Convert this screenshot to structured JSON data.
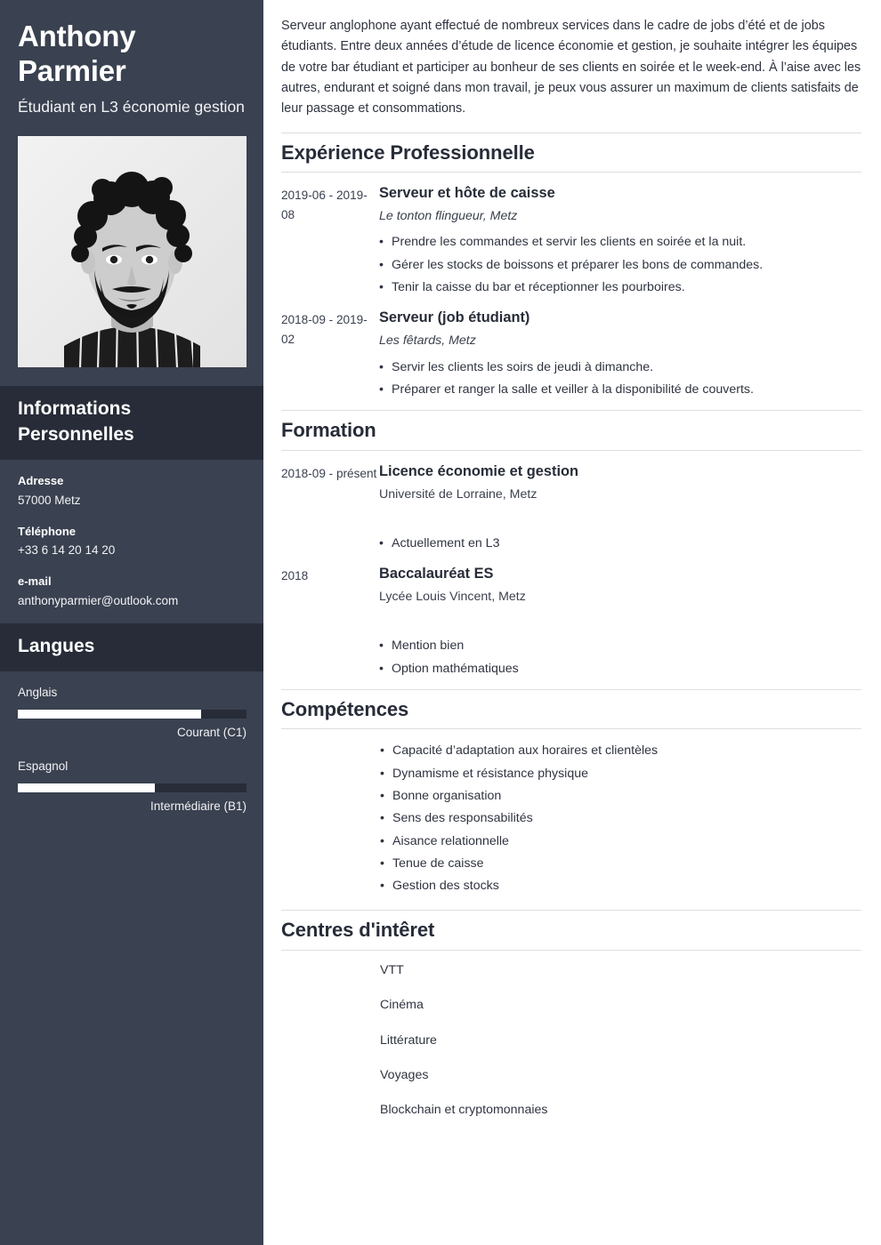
{
  "colors": {
    "sidebar_bg": "#3a4150",
    "sidebar_band_bg": "#272c38",
    "heading": "#272c38",
    "body_text": "#2f3440",
    "rule": "#dcdee1",
    "bar_fill": "#ffffff"
  },
  "sidebar": {
    "full_name": "Anthony Parmier",
    "job_title": "Étudiant en L3 économie gestion",
    "photo_alt": "portrait-photo",
    "personal_info_heading": "Informations Personnelles",
    "contacts": [
      {
        "label": "Adresse",
        "value": "57000 Metz"
      },
      {
        "label": "Téléphone",
        "value": "+33 6 14 20 14 20"
      },
      {
        "label": "e-mail",
        "value": "anthonyparmier@outlook.com"
      }
    ],
    "languages_heading": "Langues",
    "languages": [
      {
        "name": "Anglais",
        "level": "Courant (C1)",
        "percent": 80
      },
      {
        "name": "Espagnol",
        "level": "Intermédiaire (B1)",
        "percent": 60
      }
    ]
  },
  "main": {
    "summary": "Serveur anglophone ayant effectué de nombreux services dans le cadre de jobs d’été et de jobs étudiants. Entre deux années d’étude de licence économie et gestion, je souhaite intégrer les équipes de votre bar étudiant et participer au bonheur de ses clients en soirée et le week-end. À l’aise avec les autres, endurant et soigné dans mon travail, je peux vous assurer un maximum de clients satisfaits de leur passage et consommations.",
    "experience": {
      "heading": "Expérience Professionnelle",
      "entries": [
        {
          "date": "2019-06 - 2019-08",
          "title": "Serveur et hôte de caisse",
          "org": "Le tonton flingueur, Metz",
          "bullets": [
            "Prendre les commandes et servir les clients en soirée et la nuit.",
            "Gérer les stocks de boissons et préparer les bons de commandes.",
            "Tenir la caisse du bar et réceptionner les pourboires."
          ]
        },
        {
          "date": "2018-09 - 2019-02",
          "title": "Serveur (job étudiant)",
          "org": "Les fêtards, Metz",
          "bullets": [
            "Servir les clients les soirs de jeudi à dimanche.",
            "Préparer et ranger la salle et veiller à la disponibilité de couverts."
          ]
        }
      ]
    },
    "education": {
      "heading": "Formation",
      "entries": [
        {
          "date": "2018-09 - présent",
          "title": "Licence économie et gestion",
          "org": "Université de Lorraine, Metz",
          "bullets": [
            "Actuellement en L3"
          ]
        },
        {
          "date": "2018",
          "title": "Baccalauréat ES",
          "org": "Lycée Louis Vincent, Metz",
          "bullets": [
            "Mention bien",
            "Option mathématiques"
          ]
        }
      ]
    },
    "skills": {
      "heading": "Compétences",
      "items": [
        "Capacité d’adaptation aux horaires et clientèles",
        "Dynamisme et résistance physique",
        "Bonne organisation",
        "Sens des responsabilités",
        "Aisance relationnelle",
        "Tenue de caisse",
        "Gestion des stocks"
      ]
    },
    "interests": {
      "heading": "Centres d'intêret",
      "items": [
        "VTT",
        "Cinéma",
        "Littérature",
        "Voyages",
        "Blockchain et cryptomonnaies"
      ]
    }
  }
}
